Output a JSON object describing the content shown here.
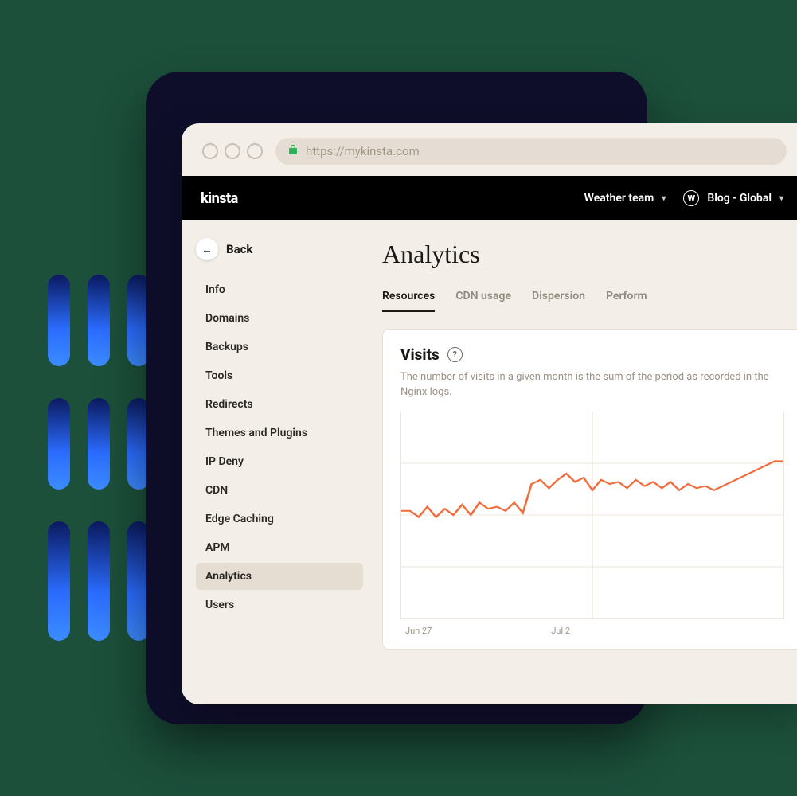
{
  "browser": {
    "url": "https://mykinsta.com"
  },
  "brand": "kinsta",
  "nav": {
    "team_label": "Weather team",
    "site_label": "Blog - Global"
  },
  "sidebar": {
    "back": "Back",
    "items": [
      {
        "label": "Info"
      },
      {
        "label": "Domains"
      },
      {
        "label": "Backups"
      },
      {
        "label": "Tools"
      },
      {
        "label": "Redirects"
      },
      {
        "label": "Themes and Plugins"
      },
      {
        "label": "IP Deny"
      },
      {
        "label": "CDN"
      },
      {
        "label": "Edge Caching"
      },
      {
        "label": "APM"
      },
      {
        "label": "Analytics"
      },
      {
        "label": "Users"
      }
    ],
    "active_index": 10
  },
  "page": {
    "title": "Analytics",
    "tabs": [
      {
        "label": "Resources"
      },
      {
        "label": "CDN usage"
      },
      {
        "label": "Dispersion"
      },
      {
        "label": "Perform"
      }
    ],
    "active_tab": 0,
    "panel": {
      "title": "Visits",
      "description": "The number of visits in a given month is the sum of the period as recorded in the Nginx logs."
    }
  },
  "chart_data": {
    "type": "line",
    "title": "Visits",
    "xlabel": "",
    "ylabel": "",
    "ylim": [
      0,
      100
    ],
    "x_ticks": [
      "Jun 27",
      "Jul 2"
    ],
    "series": [
      {
        "name": "visits",
        "values": [
          52,
          52,
          49,
          54,
          49,
          53,
          50,
          55,
          50,
          56,
          53,
          54,
          52,
          56,
          51,
          65,
          67,
          63,
          67,
          70,
          66,
          68,
          62,
          67,
          65,
          66,
          63,
          67,
          64,
          66,
          63,
          66,
          62,
          65,
          63,
          64,
          62,
          64,
          66,
          68,
          70,
          72,
          74,
          76,
          76
        ]
      }
    ]
  }
}
